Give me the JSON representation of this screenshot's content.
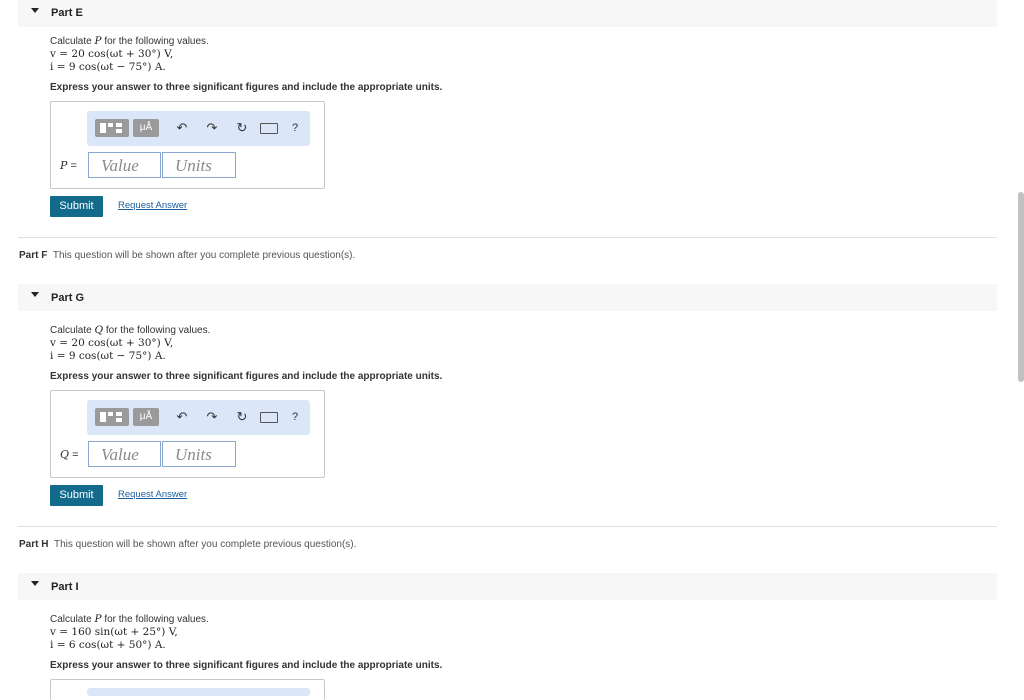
{
  "parts": {
    "E": {
      "header": "Part E",
      "prompt_pre": "Calculate ",
      "prompt_var": "P",
      "prompt_post": " for the following values.",
      "v_eq": "v = 20 cos(ωt + 30°) V,",
      "i_eq": "i = 9 cos(ωt − 75°) A.",
      "instruction": "Express your answer to three significant figures and include the appropriate units.",
      "var_label": "P",
      "eq_sign": " =",
      "value_placeholder": "Value",
      "units_placeholder": "Units",
      "submit": "Submit",
      "request": "Request Answer"
    },
    "F": {
      "label": "Part F",
      "locked_text": "This question will be shown after you complete previous question(s)."
    },
    "G": {
      "header": "Part G",
      "prompt_pre": "Calculate ",
      "prompt_var": "Q",
      "prompt_post": " for the following values.",
      "v_eq": "v = 20 cos(ωt + 30°) V,",
      "i_eq": "i = 9 cos(ωt − 75°) A.",
      "instruction": "Express your answer to three significant figures and include the appropriate units.",
      "var_label": "Q",
      "eq_sign": " =",
      "value_placeholder": "Value",
      "units_placeholder": "Units",
      "submit": "Submit",
      "request": "Request Answer"
    },
    "H": {
      "label": "Part H",
      "locked_text": "This question will be shown after you complete previous question(s)."
    },
    "I": {
      "header": "Part I",
      "prompt_pre": "Calculate ",
      "prompt_var": "P",
      "prompt_post": " for the following values.",
      "v_eq": "v = 160 sin(ωt + 25°) V,",
      "i_eq": "i = 6 cos(ωt + 50°) A.",
      "instruction": "Express your answer to three significant figures and include the appropriate units."
    }
  },
  "toolbar": {
    "units_btn": "μÅ",
    "undo": "↶",
    "redo": "↷",
    "reset": "↻",
    "help": "?"
  }
}
